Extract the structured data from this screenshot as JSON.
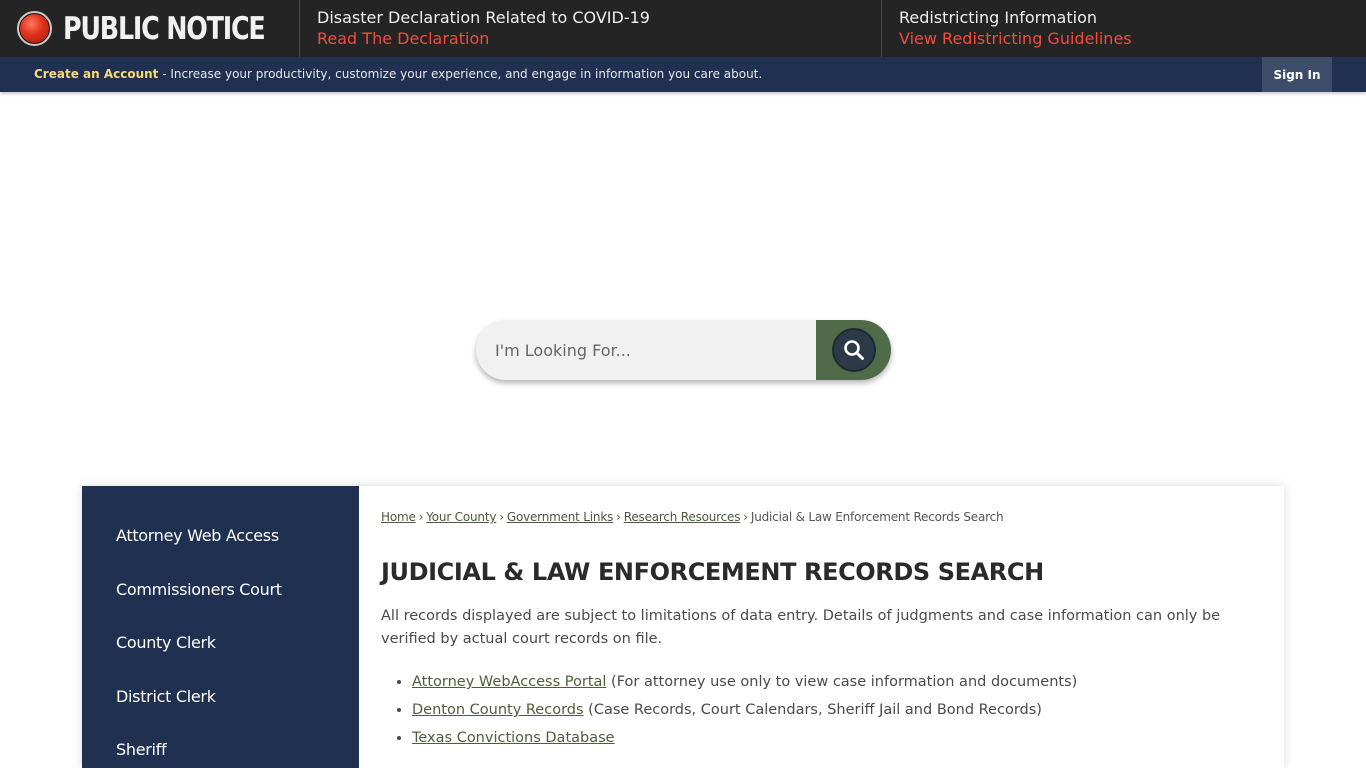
{
  "notice": {
    "title": "PUBLIC NOTICE",
    "items": [
      {
        "heading": "Disaster Declaration Related to COVID-19",
        "link": "Read The Declaration"
      },
      {
        "heading": "Redistricting Information",
        "link": "View Redistricting Guidelines"
      }
    ]
  },
  "account": {
    "create_label": "Create an Account",
    "description": " - Increase your productivity, customize your experience, and engage in information you care about.",
    "signin_label": "Sign In"
  },
  "search": {
    "placeholder": "I'm Looking For...",
    "icon": "search-icon"
  },
  "sidebar": {
    "items": [
      {
        "label": "Attorney Web Access"
      },
      {
        "label": "Commissioners Court"
      },
      {
        "label": "County Clerk"
      },
      {
        "label": "District Clerk"
      },
      {
        "label": "Sheriff"
      }
    ]
  },
  "breadcrumb": {
    "links": [
      "Home",
      "Your County",
      "Government Links",
      "Research Resources"
    ],
    "separator": "›",
    "current": "Judicial & Law Enforcement Records Search"
  },
  "page": {
    "title": "JUDICIAL & LAW ENFORCEMENT RECORDS SEARCH",
    "intro": "All records displayed are subject to limitations of data entry. Details of judgments and case information can only be verified by actual court records on file.",
    "records": [
      {
        "link": "Attorney WebAccess Portal",
        "note": " (For attorney use only to view case information and documents)"
      },
      {
        "link": "Denton County Records",
        "note": " (Case Records, Court Calendars, Sheriff Jail and Bond Records)"
      },
      {
        "link": "Texas Convictions Database",
        "note": ""
      }
    ]
  },
  "colors": {
    "notice_bg": "#242424",
    "notice_link": "#ef4d3e",
    "account_bg": "#1f3050",
    "account_link": "#f6d97a",
    "search_button": "#4f6b48",
    "sidebar_bg": "#1f3050",
    "link_green": "#4f5e3a"
  }
}
